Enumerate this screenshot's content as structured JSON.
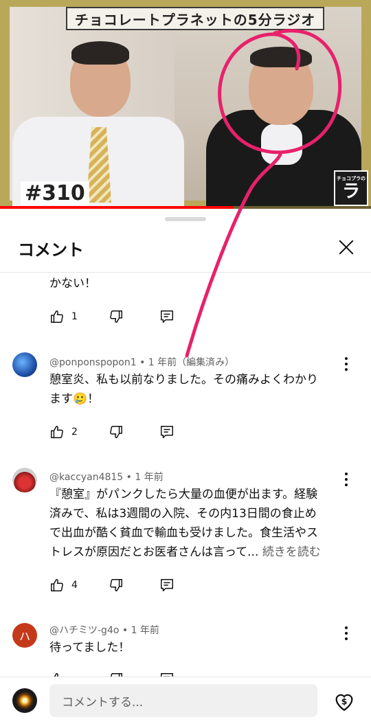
{
  "video": {
    "banner_title": "チョコレートプラネットの5分ラジオ",
    "episode_label": "#310",
    "logo_small": "チョコプラの",
    "logo_big": "ラ",
    "progress_fraction": 0.63,
    "colors": {
      "frame": "#b9a85a",
      "progress": "#ff0000",
      "annotation": "#e8216b"
    }
  },
  "sheet": {
    "title": "コメント",
    "close_icon": "close-icon"
  },
  "comments": [
    {
      "text": "かない！",
      "likes": "1",
      "partial": true
    },
    {
      "author": "@ponponspopon1",
      "time": "1 年前",
      "edited": "(編集済み)",
      "meta": "@ponponspopon1 • 1 年前（編集済み）",
      "text_line1": "憩室炎、私も以前なりました。その痛みよくわかり",
      "text_line2": "ます🥲！",
      "likes": "2",
      "avatar_color": "#2a6fd6"
    },
    {
      "author": "@kaccyan4815",
      "meta": "@kaccyan4815 • 1 年前",
      "text_line1": "『憩室』がパンクしたら大量の血便が出ます。経験",
      "text_line2": "済みで、私は3週間の入院、その内13日間の食止め",
      "text_line3": "で出血が酷く貧血で輸血も受けました。食生活やス",
      "text_line4": "トレスが原因だとお医者さんは言って...",
      "read_more": "続きを読む",
      "likes": "4",
      "avatar_color": "#c0392b"
    },
    {
      "author": "@ハチミツ-g4o",
      "meta": "@ハチミツ-g4o • 1 年前",
      "avatar_letter": "ハ",
      "text_line1": "待ってました！",
      "avatar_color": "#c5391b"
    }
  ],
  "composer": {
    "placeholder": "コメントする...",
    "thanks_icon": "super-thanks-icon"
  }
}
